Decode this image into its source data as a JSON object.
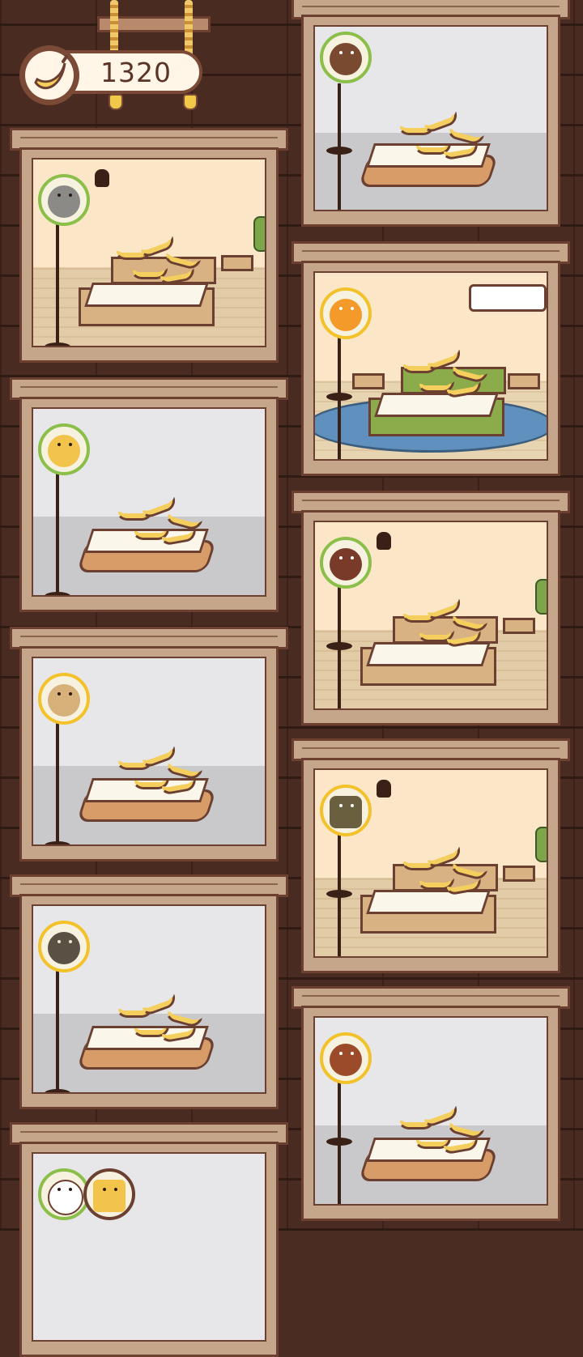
{
  "hud": {
    "banana_count": "1320",
    "coin_icon": "banana-icon"
  },
  "colors": {
    "wall": "#4a2b22",
    "frame": "#c6a68a",
    "outline": "#6b4030",
    "avatar_ring_green": "#8bbf4a",
    "avatar_ring_gold": "#f3c22a",
    "banana": "#f4cf5e"
  },
  "rooms": [
    {
      "id": "room-left-1",
      "style": "bedroom-wood",
      "tenant": "raccoon",
      "ring": "green"
    },
    {
      "id": "room-left-2",
      "style": "empty-grey",
      "tenant": "yellow-dog",
      "ring": "green"
    },
    {
      "id": "room-left-3",
      "style": "empty-grey",
      "tenant": "potato",
      "ring": "gold"
    },
    {
      "id": "room-left-4",
      "style": "empty-grey",
      "tenant": "turtle",
      "ring": "gold"
    },
    {
      "id": "room-left-5",
      "style": "empty-grey",
      "tenant": "rabbit-and-robot",
      "ring": "green"
    },
    {
      "id": "room-right-1",
      "style": "empty-grey",
      "tenant": "bear",
      "ring": "green"
    },
    {
      "id": "room-right-2",
      "style": "luxury-green",
      "tenant": "orange",
      "ring": "gold"
    },
    {
      "id": "room-right-3",
      "style": "bedroom-wood",
      "tenant": "bird",
      "ring": "green"
    },
    {
      "id": "room-right-4",
      "style": "bedroom-wood",
      "tenant": "robot",
      "ring": "gold"
    },
    {
      "id": "room-right-5",
      "style": "empty-grey",
      "tenant": "burger",
      "ring": "gold"
    }
  ]
}
